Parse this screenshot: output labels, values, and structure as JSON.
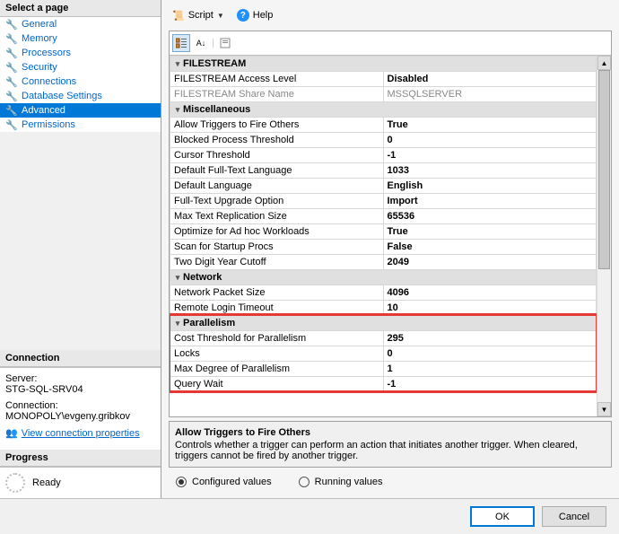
{
  "sidebar": {
    "select_header": "Select a page",
    "items": [
      {
        "label": "General"
      },
      {
        "label": "Memory"
      },
      {
        "label": "Processors"
      },
      {
        "label": "Security"
      },
      {
        "label": "Connections"
      },
      {
        "label": "Database Settings"
      },
      {
        "label": "Advanced"
      },
      {
        "label": "Permissions"
      }
    ],
    "connection_header": "Connection",
    "server_label": "Server:",
    "server_value": "STG-SQL-SRV04",
    "connection_label": "Connection:",
    "connection_value": "MONOPOLY\\evgeny.gribkov",
    "view_props_link": "View connection properties",
    "progress_header": "Progress",
    "progress_value": "Ready"
  },
  "toolbar": {
    "script_label": "Script",
    "help_label": "Help"
  },
  "grid": {
    "categories": [
      {
        "name": "FILESTREAM",
        "rows": [
          {
            "label": "FILESTREAM Access Level",
            "value": "Disabled",
            "bold": true
          },
          {
            "label": "FILESTREAM Share Name",
            "value": "MSSQLSERVER",
            "disabled": true
          }
        ]
      },
      {
        "name": "Miscellaneous",
        "rows": [
          {
            "label": "Allow Triggers to Fire Others",
            "value": "True",
            "bold": true
          },
          {
            "label": "Blocked Process Threshold",
            "value": "0",
            "bold": true
          },
          {
            "label": "Cursor Threshold",
            "value": "-1",
            "bold": true
          },
          {
            "label": "Default Full-Text Language",
            "value": "1033",
            "bold": true
          },
          {
            "label": "Default Language",
            "value": "English",
            "bold": true
          },
          {
            "label": "Full-Text Upgrade Option",
            "value": "Import",
            "bold": true
          },
          {
            "label": "Max Text Replication Size",
            "value": "65536",
            "bold": true
          },
          {
            "label": "Optimize for Ad hoc Workloads",
            "value": "True",
            "bold": true
          },
          {
            "label": "Scan for Startup Procs",
            "value": "False",
            "bold": true
          },
          {
            "label": "Two Digit Year Cutoff",
            "value": "2049",
            "bold": true
          }
        ]
      },
      {
        "name": "Network",
        "rows": [
          {
            "label": "Network Packet Size",
            "value": "4096",
            "bold": true
          },
          {
            "label": "Remote Login Timeout",
            "value": "10",
            "bold": true
          }
        ]
      },
      {
        "name": "Parallelism",
        "rows": [
          {
            "label": "Cost Threshold for Parallelism",
            "value": "295",
            "bold": true
          },
          {
            "label": "Locks",
            "value": "0",
            "bold": true
          },
          {
            "label": "Max Degree of Parallelism",
            "value": "1",
            "bold": true
          },
          {
            "label": "Query Wait",
            "value": "-1",
            "bold": true
          }
        ]
      }
    ]
  },
  "description": {
    "title": "Allow Triggers to Fire Others",
    "body": "Controls whether a trigger can perform an action that initiates another trigger. When cleared, triggers cannot be fired by another trigger."
  },
  "radios": {
    "configured": "Configured values",
    "running": "Running values"
  },
  "footer": {
    "ok": "OK",
    "cancel": "Cancel"
  }
}
